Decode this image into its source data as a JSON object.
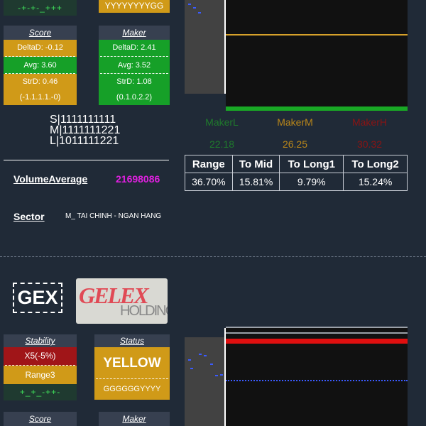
{
  "block1": {
    "top_trend": "-+-+-_+++",
    "top_status_text": "YYYYYYYYGG",
    "score": {
      "header": "Score",
      "delta": "DeltaD: -0.12",
      "avg": "Avg: 3.60",
      "strd": "StrD: 0.46",
      "strd_seq": "(-1.1.1.1.-0)"
    },
    "maker": {
      "header": "Maker",
      "delta": "DeltaD: 2.41",
      "avg": "Avg: 3.52",
      "strd": "StrD: 1.08",
      "strd_seq": "(0.1.0.2.2)"
    },
    "signals": [
      "S|1111111111",
      "M|1111111221",
      "L|1011111221"
    ],
    "volume_label": "VolumeAverage",
    "volume_value": "21698086",
    "sector_label": "Sector",
    "sector_value": "M_ TAI CHINH - NGAN HANG",
    "makers": [
      {
        "name": "MakerL",
        "value": "22.18",
        "color": "#1f7a2c"
      },
      {
        "name": "MakerM",
        "value": "26.25",
        "color": "#b8861a"
      },
      {
        "name": "MakerH",
        "value": "30.32",
        "color": "#8a1414"
      }
    ],
    "stats_headers": [
      "Range",
      "To Mid",
      "To Long1",
      "To Long2"
    ],
    "stats_values": [
      "36.70%",
      "15.81%",
      "9.79%",
      "15.24%"
    ]
  },
  "block2": {
    "ticker": "GEX",
    "logo_text_main": "GELEX",
    "logo_text_sub": "HOLDINGS",
    "stability": {
      "header": "Stability",
      "value": "X5(-5%)",
      "range": "Range3",
      "trend": "+_+_-++-"
    },
    "status": {
      "header": "Status",
      "value": "YELLOW",
      "seq": "GGGGGGYYYY"
    },
    "score_header": "Score",
    "maker_header": "Maker"
  },
  "colors": {
    "background": "#202a37",
    "yellow": "#d09a18",
    "green": "#16a028",
    "red": "#a01518",
    "magenta": "#e020e0",
    "orange_line": "#d6a12a"
  }
}
